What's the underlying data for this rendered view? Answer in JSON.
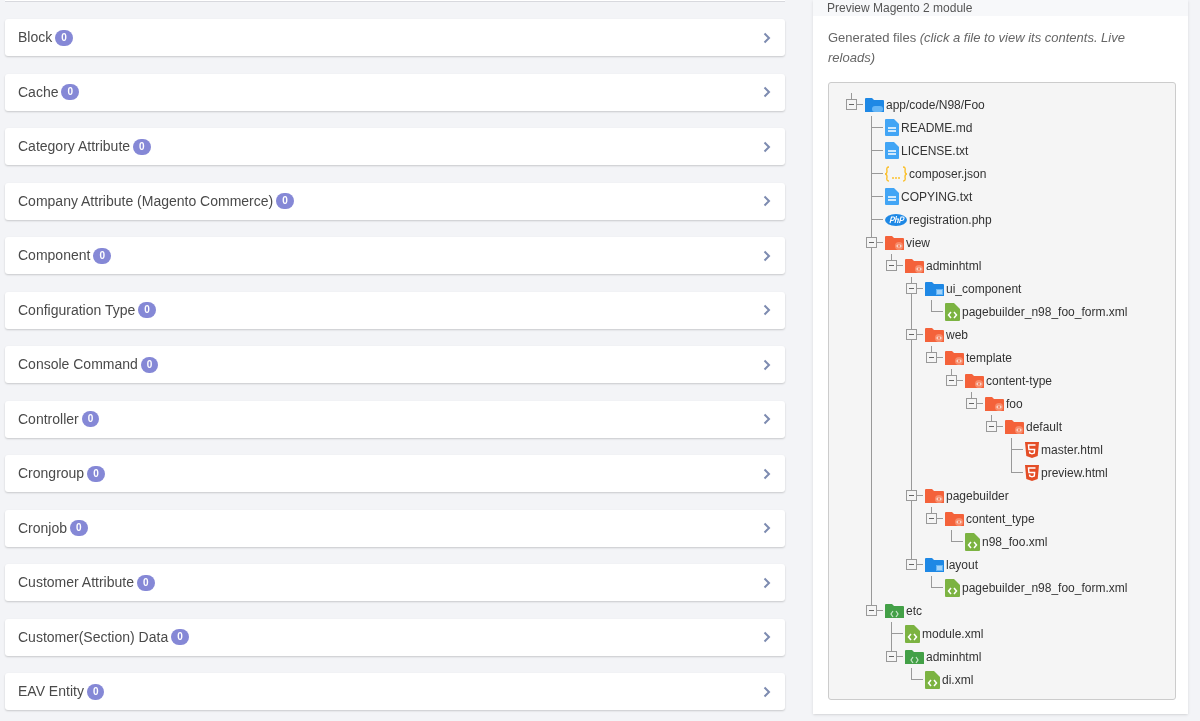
{
  "entity_types": [
    {
      "label": "Block",
      "count": "0"
    },
    {
      "label": "Cache",
      "count": "0"
    },
    {
      "label": "Category Attribute",
      "count": "0"
    },
    {
      "label": "Company Attribute (Magento Commerce)",
      "count": "0"
    },
    {
      "label": "Component",
      "count": "0"
    },
    {
      "label": "Configuration Type",
      "count": "0"
    },
    {
      "label": "Console Command",
      "count": "0"
    },
    {
      "label": "Controller",
      "count": "0"
    },
    {
      "label": "Crongroup",
      "count": "0"
    },
    {
      "label": "Cronjob",
      "count": "0"
    },
    {
      "label": "Customer Attribute",
      "count": "0"
    },
    {
      "label": "Customer(Section) Data",
      "count": "0"
    },
    {
      "label": "EAV Entity",
      "count": "0"
    }
  ],
  "preview": {
    "title": "Preview Magento 2 module",
    "intro": "Generated files",
    "hint": "(click a file to view its contents. Live reloads)",
    "tree": [
      {
        "name": "app/code/N98/Foo",
        "kind": "php-folder",
        "expanded": true,
        "children": [
          {
            "name": "README.md",
            "kind": "text-file"
          },
          {
            "name": "LICENSE.txt",
            "kind": "text-file"
          },
          {
            "name": "composer.json",
            "kind": "json-file"
          },
          {
            "name": "COPYING.txt",
            "kind": "text-file"
          },
          {
            "name": "registration.php",
            "kind": "php-file"
          },
          {
            "name": "view",
            "kind": "web-folder",
            "expanded": true,
            "children": [
              {
                "name": "adminhtml",
                "kind": "web-folder",
                "expanded": true,
                "children": [
                  {
                    "name": "ui_component",
                    "kind": "ui-folder",
                    "expanded": true,
                    "children": [
                      {
                        "name": "pagebuilder_n98_foo_form.xml",
                        "kind": "xml-file"
                      }
                    ]
                  },
                  {
                    "name": "web",
                    "kind": "web-folder",
                    "expanded": true,
                    "children": [
                      {
                        "name": "template",
                        "kind": "web-folder",
                        "expanded": true,
                        "children": [
                          {
                            "name": "content-type",
                            "kind": "web-folder",
                            "expanded": true,
                            "children": [
                              {
                                "name": "foo",
                                "kind": "web-folder",
                                "expanded": true,
                                "children": [
                                  {
                                    "name": "default",
                                    "kind": "web-folder",
                                    "expanded": true,
                                    "children": [
                                      {
                                        "name": "master.html",
                                        "kind": "html-file"
                                      },
                                      {
                                        "name": "preview.html",
                                        "kind": "html-file"
                                      }
                                    ]
                                  }
                                ]
                              }
                            ]
                          }
                        ]
                      }
                    ]
                  },
                  {
                    "name": "pagebuilder",
                    "kind": "web-folder",
                    "expanded": true,
                    "children": [
                      {
                        "name": "content_type",
                        "kind": "web-folder",
                        "expanded": true,
                        "children": [
                          {
                            "name": "n98_foo.xml",
                            "kind": "xml-file"
                          }
                        ]
                      }
                    ]
                  },
                  {
                    "name": "layout",
                    "kind": "ui-folder",
                    "expanded": true,
                    "children": [
                      {
                        "name": "pagebuilder_n98_foo_form.xml",
                        "kind": "xml-file"
                      }
                    ]
                  }
                ]
              }
            ]
          },
          {
            "name": "etc",
            "kind": "config-folder",
            "expanded": true,
            "children": [
              {
                "name": "module.xml",
                "kind": "xml-file"
              },
              {
                "name": "adminhtml",
                "kind": "config-folder",
                "expanded": true,
                "children": [
                  {
                    "name": "di.xml",
                    "kind": "xml-file"
                  }
                ]
              }
            ]
          }
        ]
      }
    ]
  }
}
